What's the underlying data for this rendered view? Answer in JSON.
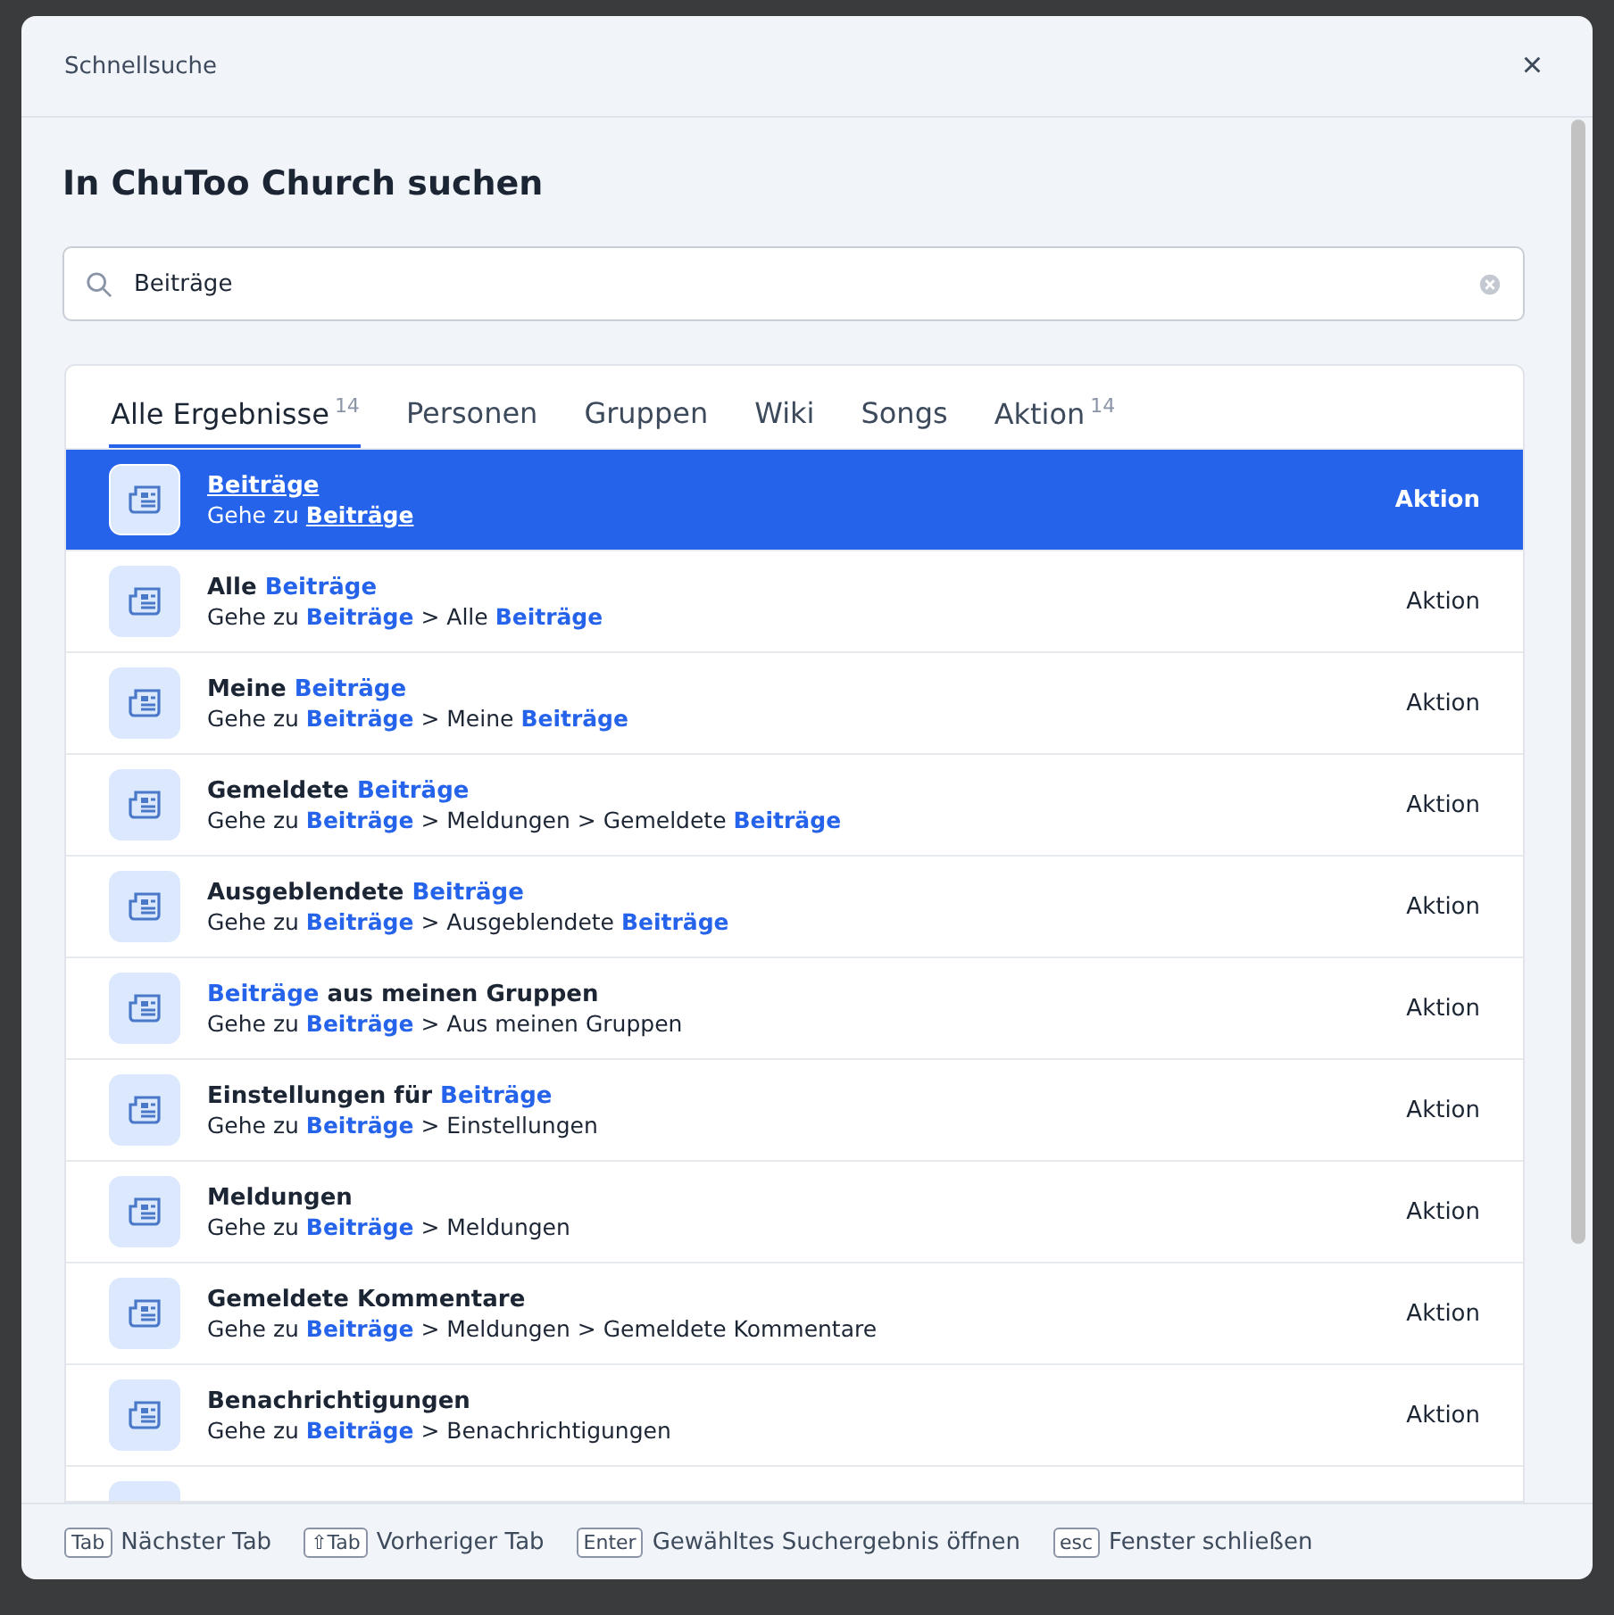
{
  "dialog": {
    "title": "Schnellsuche",
    "close": "×"
  },
  "heading": "In ChuToo Church suchen",
  "search": {
    "value": "Beiträge"
  },
  "tabs": [
    {
      "label": "Alle Ergebnisse",
      "count": "14",
      "selected": true
    },
    {
      "label": "Personen",
      "selected": false
    },
    {
      "label": "Gruppen",
      "selected": false
    },
    {
      "label": "Wiki",
      "selected": false
    },
    {
      "label": "Songs",
      "selected": false
    },
    {
      "label": "Aktion",
      "count": "14",
      "selected": false
    }
  ],
  "results": [
    {
      "title": "**Beiträge**",
      "path": "Gehe zu **Beiträge**",
      "type": "Aktion",
      "selected": true
    },
    {
      "title": "Alle **Beiträge**",
      "path": "Gehe zu **Beiträge** > Alle **Beiträge**",
      "type": "Aktion",
      "selected": false
    },
    {
      "title": "Meine **Beiträge**",
      "path": "Gehe zu **Beiträge** > Meine **Beiträge**",
      "type": "Aktion",
      "selected": false
    },
    {
      "title": "Gemeldete **Beiträge**",
      "path": "Gehe zu **Beiträge** > Meldungen > Gemeldete **Beiträge**",
      "type": "Aktion",
      "selected": false
    },
    {
      "title": "Ausgeblendete **Beiträge**",
      "path": "Gehe zu **Beiträge** > Ausgeblendete **Beiträge**",
      "type": "Aktion",
      "selected": false
    },
    {
      "title": "**Beiträge** aus meinen Gruppen",
      "path": "Gehe zu **Beiträge** > Aus meinen Gruppen",
      "type": "Aktion",
      "selected": false
    },
    {
      "title": "Einstellungen für **Beiträge**",
      "path": "Gehe zu **Beiträge** > Einstellungen",
      "type": "Aktion",
      "selected": false
    },
    {
      "title": "Meldungen",
      "path": "Gehe zu **Beiträge** > Meldungen",
      "type": "Aktion",
      "selected": false
    },
    {
      "title": "Gemeldete Kommentare",
      "path": "Gehe zu **Beiträge** > Meldungen > Gemeldete Kommentare",
      "type": "Aktion",
      "selected": false
    },
    {
      "title": "Benachrichtigungen",
      "path": "Gehe zu **Beiträge** > Benachrichtigungen",
      "type": "Aktion",
      "selected": false
    },
    {
      "selected": false
    }
  ],
  "shortcuts": [
    {
      "key": "Tab",
      "label": "Nächster Tab"
    },
    {
      "key": "⇧Tab",
      "label": "Vorheriger Tab"
    },
    {
      "key": "Enter",
      "label": "Gewähltes Suchergebnis öffnen"
    },
    {
      "key": "esc",
      "label": "Fenster schließen"
    }
  ]
}
